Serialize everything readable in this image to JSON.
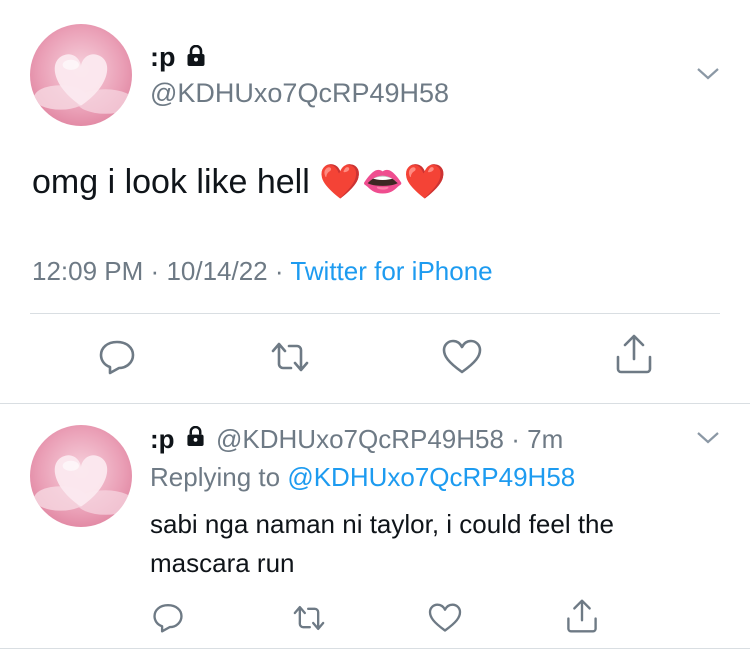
{
  "main_tweet": {
    "display_name": ":p",
    "handle": "@KDHUxo7QcRP49H58",
    "text": "omg i look like hell ❤️👄❤️",
    "time": "12:09 PM",
    "date": "10/14/22",
    "source": "Twitter for iPhone",
    "separator": "·"
  },
  "reply_tweet": {
    "display_name": ":p",
    "handle": "@KDHUxo7QcRP49H58",
    "age": "7m",
    "separator": "·",
    "replying_prefix": "Replying to",
    "replying_handle": "@KDHUxo7QcRP49H58",
    "text_line1": "sabi nga naman ni taylor, i could feel the",
    "text_line2": "mascara run"
  },
  "icons": {
    "reply": "reply-icon",
    "retweet": "retweet-icon",
    "like": "heart-icon",
    "share": "share-icon",
    "lock": "lock-icon",
    "more": "chevron-down-icon"
  },
  "colors": {
    "link": "#1d9bf0",
    "muted": "#6e7a85",
    "text": "#0f1419",
    "divider": "#d9dee2"
  }
}
